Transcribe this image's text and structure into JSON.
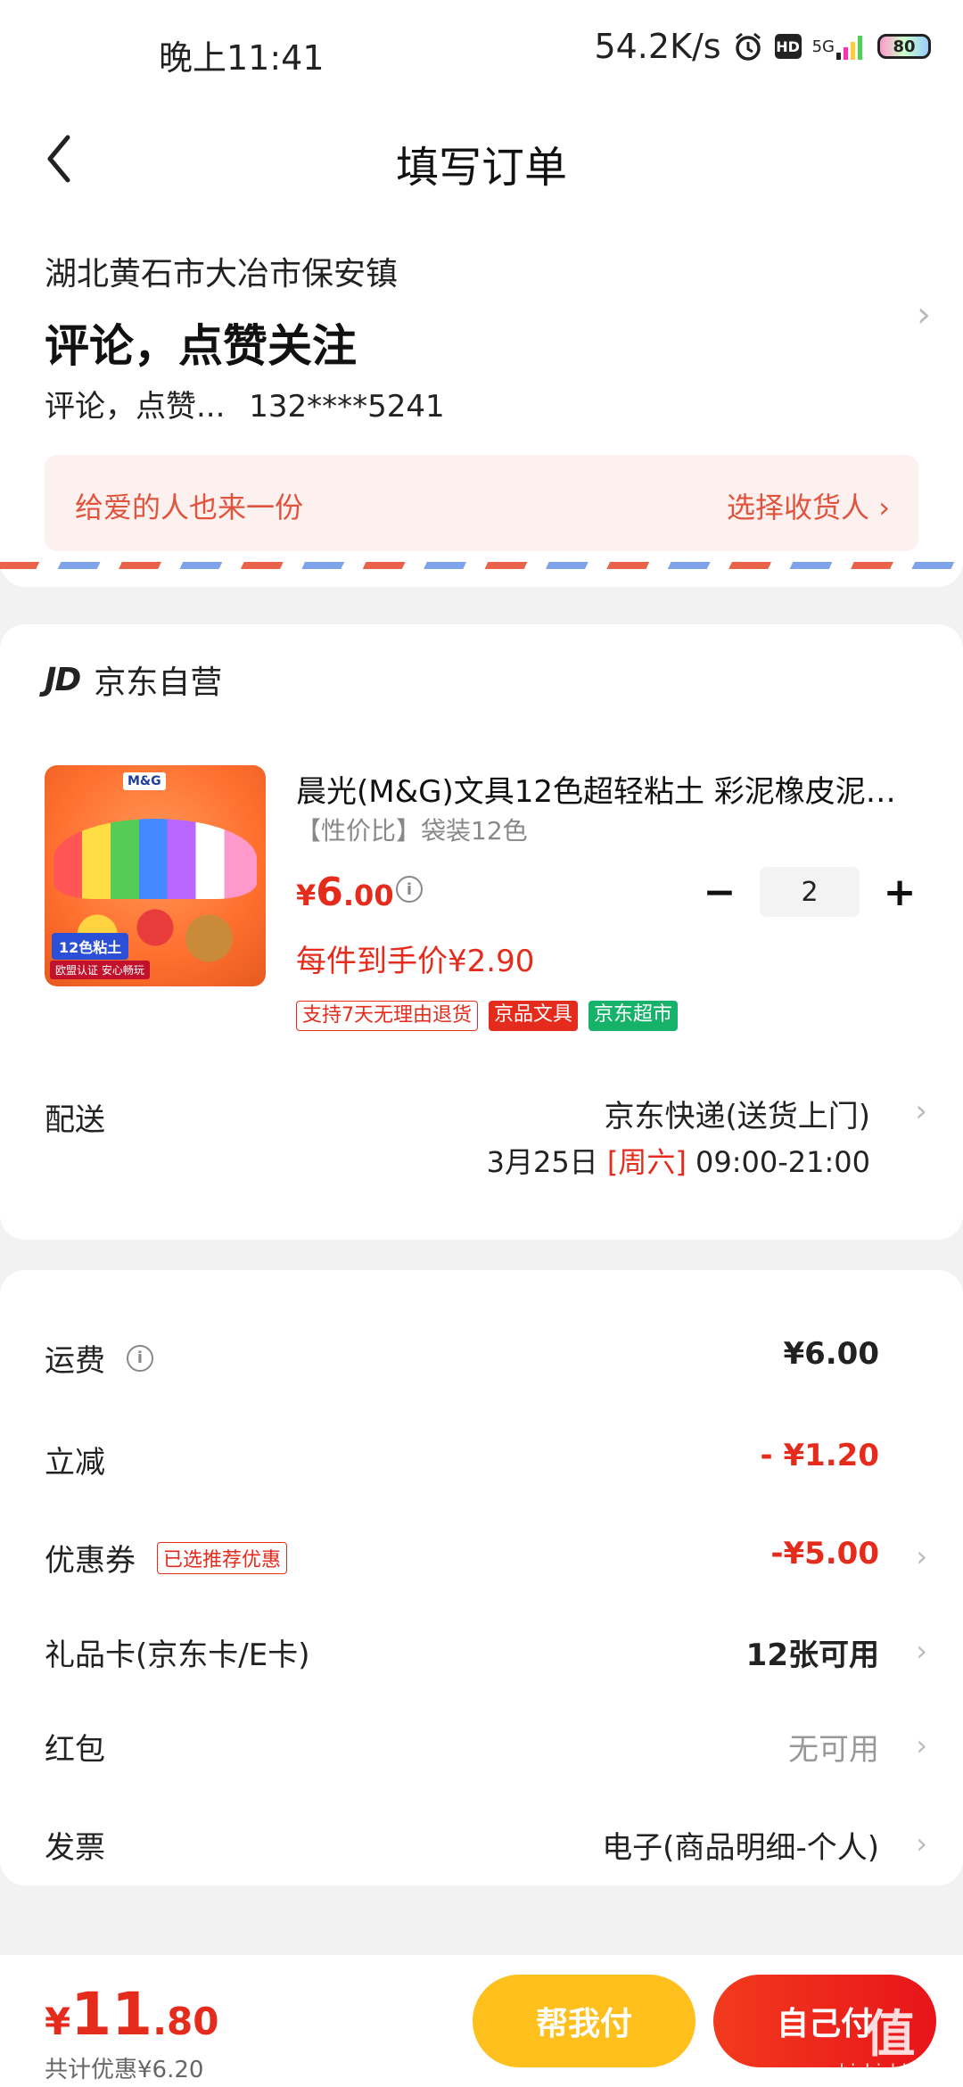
{
  "status_bar": {
    "time": "晚上11:41",
    "network_speed": "54.2K/s",
    "hd": "HD",
    "signal": "5G",
    "battery": "80"
  },
  "header": {
    "title": "填写订单"
  },
  "address": {
    "region": "湖北黄石市大冶市保安镇",
    "detail": "评论，点赞关注",
    "name": "评论，点赞...",
    "phone": "132****5241",
    "gift_text": "给爱的人也来一份",
    "gift_action": "选择收货人 ›"
  },
  "shop": {
    "logo": "JD",
    "name": "京东自营"
  },
  "product": {
    "image_brand": "M&G",
    "image_badge": "12色粘土",
    "image_sub": "欧盟认证 安心畅玩",
    "title": "晨光(M&G)文具12色超轻粘土 彩泥橡皮泥…",
    "spec": "【性价比】袋装12色",
    "price_yen": "¥",
    "price_int": "6",
    "price_dec": ".00",
    "unit_price": "每件到手价¥2.90",
    "quantity": "2",
    "tags": [
      "支持7天无理由退货",
      "京品文具",
      "京东超市"
    ]
  },
  "delivery": {
    "label": "配送",
    "method": "京东快递(送货上门)",
    "date": "3月25日",
    "weekday": "[周六]",
    "time": "09:00-21:00"
  },
  "fees": {
    "shipping_label": "运费",
    "shipping_value": "¥6.00",
    "discount_label": "立减",
    "discount_value": "- ¥1.20",
    "coupon_label": "优惠券",
    "coupon_tag": "已选推荐优惠",
    "coupon_value": "-¥5.00",
    "giftcard_label": "礼品卡(京东卡/E卡)",
    "giftcard_value": "12张可用",
    "redpacket_label": "红包",
    "redpacket_value": "无可用",
    "invoice_label": "发票",
    "invoice_value": "电子(商品明细-个人)"
  },
  "footer": {
    "total_yen": "¥",
    "total_int": "11",
    "total_dec": ".80",
    "total_discount": "共计优惠¥6.20",
    "pay_help": "帮我付",
    "pay_self": "自己付",
    "watermark_glyph": "值",
    "watermark_url": "zhizhizhi.com"
  },
  "colors": {
    "accent_red": "#e52b1c",
    "gift_bg": "#fdf1ef",
    "help_pay_yellow": "#ffbf1c",
    "tag_green": "#17b26a"
  }
}
